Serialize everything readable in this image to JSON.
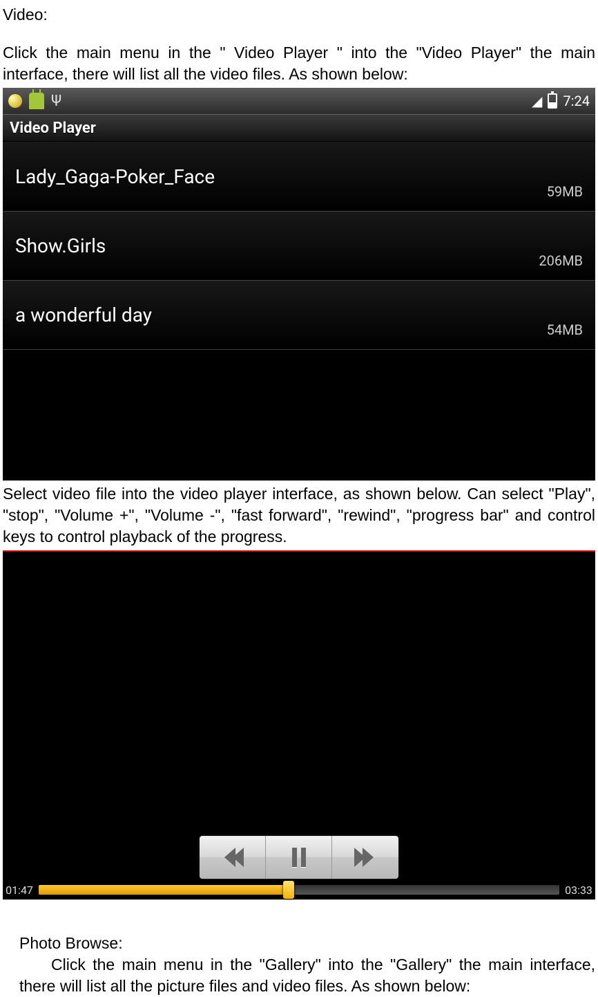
{
  "doc": {
    "heading1": "Video:",
    "para1": "Click the main menu in the \" Video Player \" into the \"Video Player\" the main interface, there will list all the video files. As shown below:",
    "para2": "Select video file into the video player interface, as shown below. Can select \"Play\", \"stop\", \"Volume +\", \"Volume -\", \"fast forward\", \"rewind\", \"progress bar\" and control keys to control playback of the progress.",
    "heading2": "Photo Browse:",
    "para3": "Click the main menu in the \"Gallery\" into the \"Gallery\" the main interface, there will list all the picture files and video files. As shown below:"
  },
  "screenshot1": {
    "status_time": "7:24",
    "title": "Video Player",
    "rows": [
      {
        "name": "Lady_Gaga-Poker_Face",
        "size": "59MB"
      },
      {
        "name": "Show.Girls",
        "size": "206MB"
      },
      {
        "name": "a wonderful day",
        "size": "54MB"
      }
    ]
  },
  "screenshot2": {
    "elapsed": "01:47",
    "total": "03:33"
  }
}
